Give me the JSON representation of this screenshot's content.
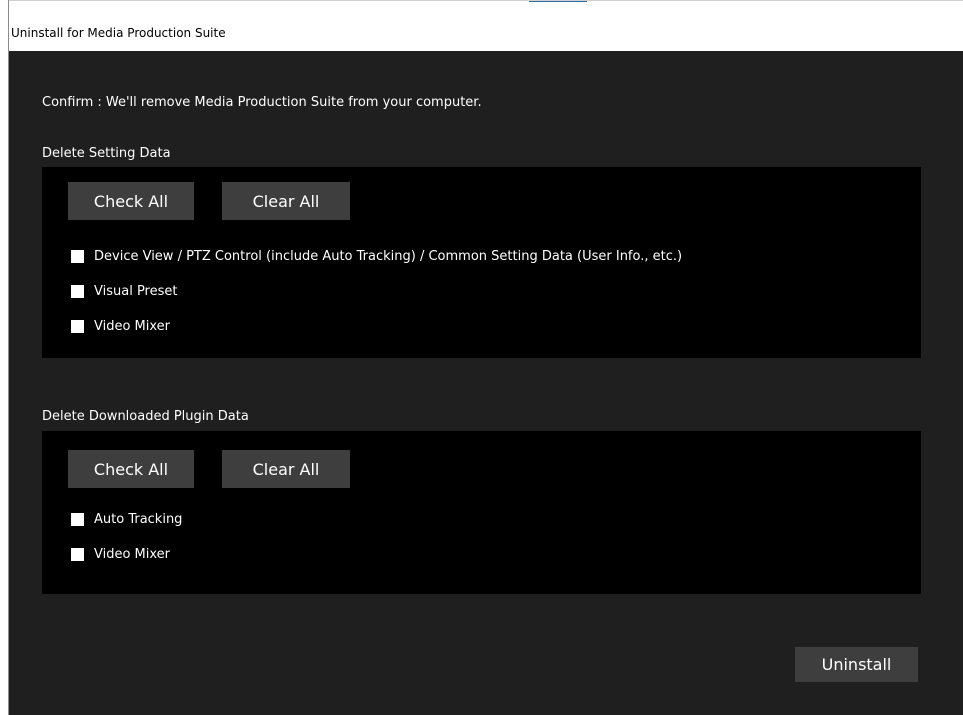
{
  "window": {
    "title": "Uninstall for Media Production Suite"
  },
  "confirm_text": "Confirm : We'll remove Media Production Suite from your computer.",
  "setting_section": {
    "label": "Delete Setting Data",
    "check_all_label": "Check All",
    "clear_all_label": "Clear All",
    "options": [
      {
        "label": "Device View / PTZ Control (include Auto Tracking) / Common Setting Data (User Info., etc.)",
        "checked": false
      },
      {
        "label": "Visual Preset",
        "checked": false
      },
      {
        "label": "Video Mixer",
        "checked": false
      }
    ]
  },
  "plugin_section": {
    "label": "Delete Downloaded Plugin Data",
    "check_all_label": "Check All",
    "clear_all_label": "Clear All",
    "options": [
      {
        "label": "Auto Tracking",
        "checked": false
      },
      {
        "label": "Video Mixer",
        "checked": false
      }
    ]
  },
  "uninstall_label": "Uninstall",
  "colors": {
    "client_background": "#1f1f1f",
    "panel_background": "#000000",
    "button_background": "#3e3e3e",
    "text": "#ffffff"
  }
}
